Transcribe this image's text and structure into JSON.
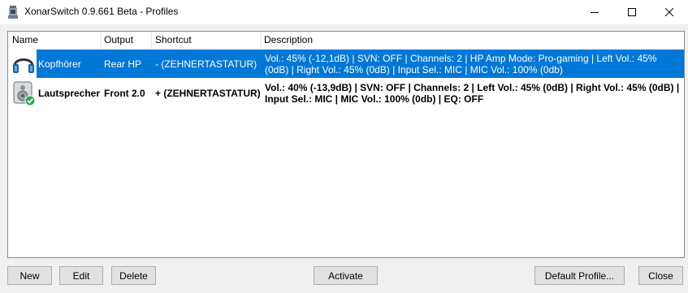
{
  "window": {
    "title": "XonarSwitch 0.9.661 Beta - Profiles"
  },
  "colors": {
    "selection": "#0078d7",
    "check_badge": "#2fa84f"
  },
  "list": {
    "columns": [
      "Name",
      "Output",
      "Shortcut",
      "Description"
    ],
    "rows": [
      {
        "name": "Kopfhörer",
        "output": "Rear HP",
        "shortcut": "- (ZEHNERTASTATUR)",
        "description": "Vol.: 45% (-12,1dB) | SVN: OFF | Channels: 2 | HP Amp Mode: Pro-gaming | Left Vol.: 45% (0dB) | Right Vol.: 45% (0dB) | Input Sel.: MIC | MIC Vol.: 100% (0db)",
        "icon": "headphones-icon",
        "selected": true,
        "active": false
      },
      {
        "name": "Lautsprecher",
        "output": "Front 2.0",
        "shortcut": "+ (ZEHNERTASTATUR)",
        "description": "Vol.: 40% (-13,9dB) | SVN: OFF | Channels: 2 | Left Vol.: 45% (0dB) | Right Vol.: 45% (0dB) | Input Sel.: MIC | MIC Vol.: 100% (0db) | EQ: OFF",
        "icon": "speaker-icon",
        "selected": false,
        "active": true
      }
    ]
  },
  "buttons": {
    "new": "New",
    "edit": "Edit",
    "delete": "Delete",
    "activate": "Activate",
    "default_profile": "Default Profile...",
    "close": "Close"
  }
}
